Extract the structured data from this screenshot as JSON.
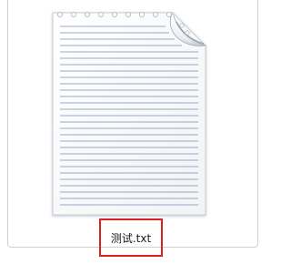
{
  "file": {
    "name": "测试.txt",
    "icon": "text-document-icon"
  },
  "highlight": {
    "color": "#d9221c"
  }
}
